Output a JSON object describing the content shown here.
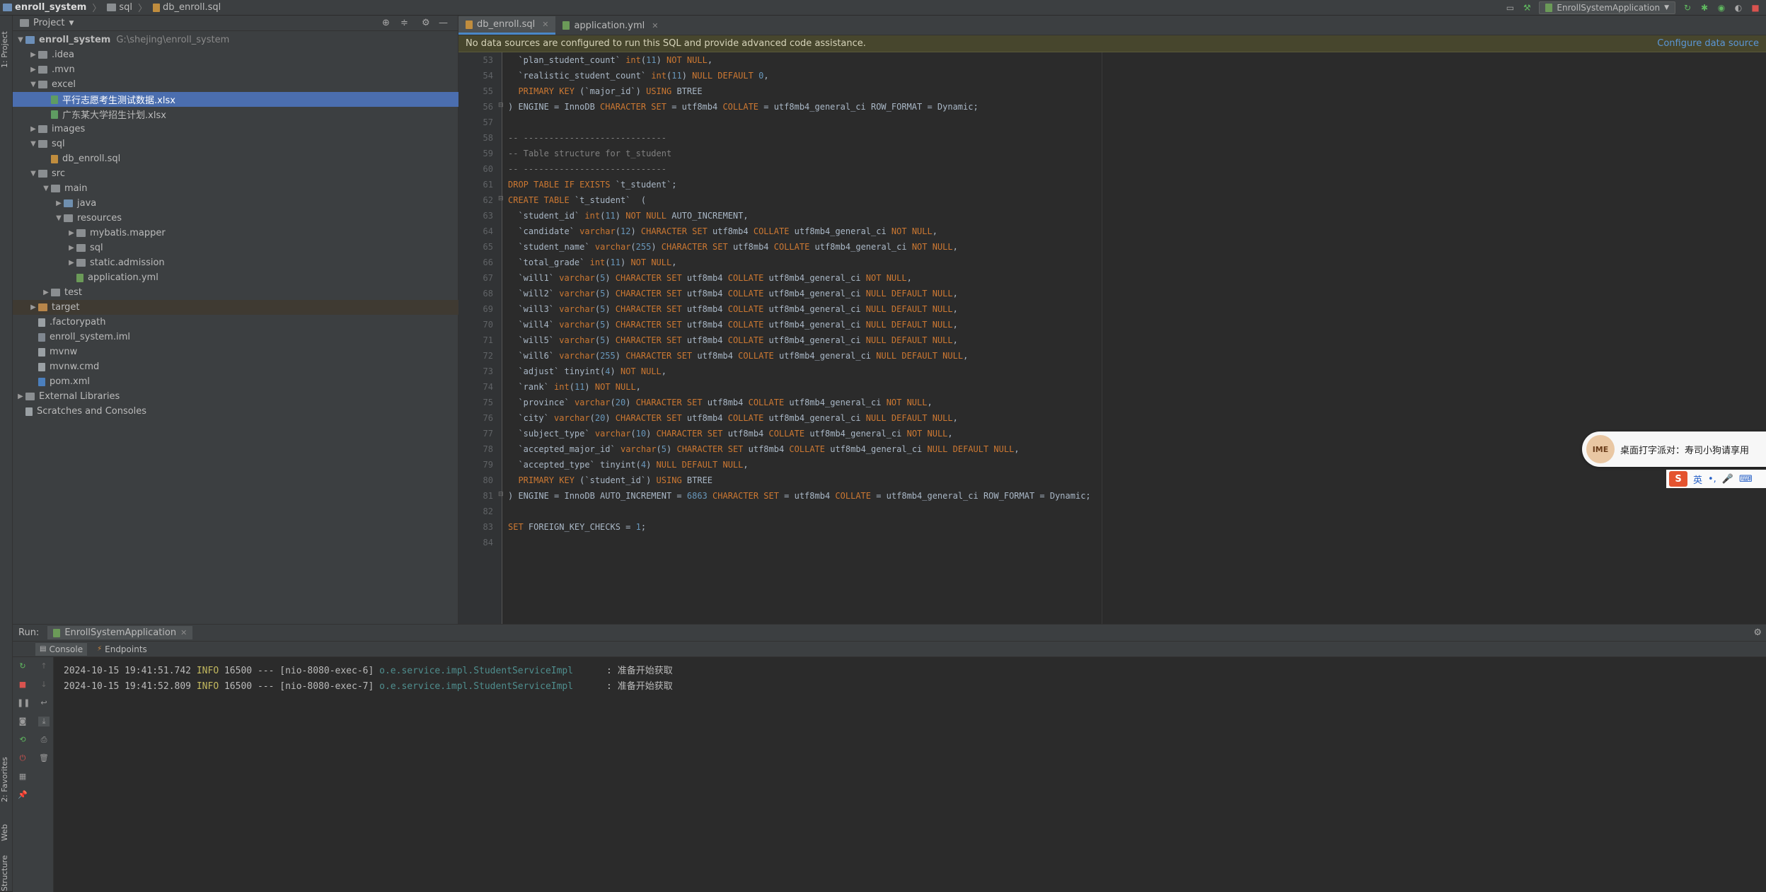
{
  "breadcrumb": {
    "project": "enroll_system",
    "folder": "sql",
    "file": "db_enroll.sql"
  },
  "toolbar": {
    "run_config": "EnrollSystemApplication"
  },
  "left_strip": {
    "project_tab": "1: Project",
    "favorites_tab": "2: Favorites",
    "web_tab": "Web",
    "structure_tab": "Structure"
  },
  "project_panel": {
    "title": "Project",
    "tree": [
      {
        "label": "enroll_system",
        "path": "G:\\shejing\\enroll_system",
        "depth": 0,
        "arrow": "▼",
        "icon": "ficon blue",
        "bold": true
      },
      {
        "label": ".idea",
        "depth": 1,
        "arrow": "▶",
        "icon": "ficon"
      },
      {
        "label": ".mvn",
        "depth": 1,
        "arrow": "▶",
        "icon": "ficon"
      },
      {
        "label": "excel",
        "depth": 1,
        "arrow": "▼",
        "icon": "ficon"
      },
      {
        "label": "平行志愿考生测试数据.xlsx",
        "depth": 2,
        "arrow": "",
        "icon": "fileicon xls",
        "selected": true
      },
      {
        "label": "广东某大学招生计划.xlsx",
        "depth": 2,
        "arrow": "",
        "icon": "fileicon xls"
      },
      {
        "label": "images",
        "depth": 1,
        "arrow": "▶",
        "icon": "ficon"
      },
      {
        "label": "sql",
        "depth": 1,
        "arrow": "▼",
        "icon": "ficon"
      },
      {
        "label": "db_enroll.sql",
        "depth": 2,
        "arrow": "",
        "icon": "fileicon sql"
      },
      {
        "label": "src",
        "depth": 1,
        "arrow": "▼",
        "icon": "ficon"
      },
      {
        "label": "main",
        "depth": 2,
        "arrow": "▼",
        "icon": "ficon"
      },
      {
        "label": "java",
        "depth": 3,
        "arrow": "▶",
        "icon": "ficon src"
      },
      {
        "label": "resources",
        "depth": 3,
        "arrow": "▼",
        "icon": "ficon"
      },
      {
        "label": "mybatis.mapper",
        "depth": 4,
        "arrow": "▶",
        "icon": "ficon"
      },
      {
        "label": "sql",
        "depth": 4,
        "arrow": "▶",
        "icon": "ficon"
      },
      {
        "label": "static.admission",
        "depth": 4,
        "arrow": "▶",
        "icon": "ficon"
      },
      {
        "label": "application.yml",
        "depth": 4,
        "arrow": "",
        "icon": "fileicon yml"
      },
      {
        "label": "test",
        "depth": 2,
        "arrow": "▶",
        "icon": "ficon"
      },
      {
        "label": "target",
        "depth": 1,
        "arrow": "▶",
        "icon": "ficon orange",
        "target": true
      },
      {
        "label": ".factorypath",
        "depth": 1,
        "arrow": "",
        "icon": "fileicon"
      },
      {
        "label": "enroll_system.iml",
        "depth": 1,
        "arrow": "",
        "icon": "fileicon iml"
      },
      {
        "label": "mvnw",
        "depth": 1,
        "arrow": "",
        "icon": "fileicon"
      },
      {
        "label": "mvnw.cmd",
        "depth": 1,
        "arrow": "",
        "icon": "fileicon"
      },
      {
        "label": "pom.xml",
        "depth": 1,
        "arrow": "",
        "icon": "fileicon pom"
      },
      {
        "label": "External Libraries",
        "depth": 0,
        "arrow": "▶",
        "icon": "ficon"
      },
      {
        "label": "Scratches and Consoles",
        "depth": 0,
        "arrow": "",
        "icon": "fileicon"
      }
    ]
  },
  "editor": {
    "tabs": [
      {
        "label": "db_enroll.sql",
        "active": true
      },
      {
        "label": "application.yml",
        "active": false
      }
    ],
    "banner": {
      "message": "No data sources are configured to run this SQL and provide advanced code assistance.",
      "link": "Configure data source"
    },
    "lines": [
      {
        "n": "53",
        "html": "  <span class='id'>`plan_student_count`</span> <span class='kw'>int</span>(<span class='num'>11</span>) <span class='kw'>NOT NULL</span>,"
      },
      {
        "n": "54",
        "html": "  <span class='id'>`realistic_student_count`</span> <span class='kw'>int</span>(<span class='num'>11</span>) <span class='kw'>NULL DEFAULT</span> <span class='num'>0</span>,"
      },
      {
        "n": "55",
        "html": "  <span class='kw'>PRIMARY KEY</span> (<span class='id'>`major_id`</span>) <span class='kw'>USING</span> BTREE"
      },
      {
        "n": "56",
        "html": ") ENGINE = InnoDB <span class='kw'>CHARACTER SET</span> = utf8mb4 <span class='kw'>COLLATE</span> = utf8mb4_general_ci ROW_FORMAT = Dynamic;"
      },
      {
        "n": "57",
        "html": ""
      },
      {
        "n": "58",
        "html": "<span class='cm'>-- ----------------------------</span>"
      },
      {
        "n": "59",
        "html": "<span class='cm'>-- Table structure for t_student</span>"
      },
      {
        "n": "60",
        "html": "<span class='cm'>-- ----------------------------</span>"
      },
      {
        "n": "61",
        "html": "<span class='kw'>DROP TABLE IF EXISTS</span> <span class='id'>`t_student`</span>;"
      },
      {
        "n": "62",
        "html": "<span class='kw'>CREATE TABLE</span> <span class='id'>`t_student`</span>  ("
      },
      {
        "n": "63",
        "html": "  <span class='id'>`student_id`</span> <span class='kw'>int</span>(<span class='num'>11</span>) <span class='kw'>NOT NULL</span> AUTO_INCREMENT,"
      },
      {
        "n": "64",
        "html": "  <span class='id'>`candidate`</span> <span class='kw'>varchar</span>(<span class='num'>12</span>) <span class='kw'>CHARACTER SET</span> utf8mb4 <span class='kw'>COLLATE</span> utf8mb4_general_ci <span class='kw'>NOT NULL</span>,"
      },
      {
        "n": "65",
        "html": "  <span class='id'>`student_name`</span> <span class='kw'>varchar</span>(<span class='num'>255</span>) <span class='kw'>CHARACTER SET</span> utf8mb4 <span class='kw'>COLLATE</span> utf8mb4_general_ci <span class='kw'>NOT NULL</span>,"
      },
      {
        "n": "66",
        "html": "  <span class='id'>`total_grade`</span> <span class='kw'>int</span>(<span class='num'>11</span>) <span class='kw'>NOT NULL</span>,"
      },
      {
        "n": "67",
        "html": "  <span class='id'>`will1`</span> <span class='kw'>varchar</span>(<span class='num'>5</span>) <span class='kw'>CHARACTER SET</span> utf8mb4 <span class='kw'>COLLATE</span> utf8mb4_general_ci <span class='kw'>NOT NULL</span>,"
      },
      {
        "n": "68",
        "html": "  <span class='id'>`will2`</span> <span class='kw'>varchar</span>(<span class='num'>5</span>) <span class='kw'>CHARACTER SET</span> utf8mb4 <span class='kw'>COLLATE</span> utf8mb4_general_ci <span class='kw'>NULL DEFAULT NULL</span>,"
      },
      {
        "n": "69",
        "html": "  <span class='id'>`will3`</span> <span class='kw'>varchar</span>(<span class='num'>5</span>) <span class='kw'>CHARACTER SET</span> utf8mb4 <span class='kw'>COLLATE</span> utf8mb4_general_ci <span class='kw'>NULL DEFAULT NULL</span>,"
      },
      {
        "n": "70",
        "html": "  <span class='id'>`will4`</span> <span class='kw'>varchar</span>(<span class='num'>5</span>) <span class='kw'>CHARACTER SET</span> utf8mb4 <span class='kw'>COLLATE</span> utf8mb4_general_ci <span class='kw'>NULL DEFAULT NULL</span>,"
      },
      {
        "n": "71",
        "html": "  <span class='id'>`will5`</span> <span class='kw'>varchar</span>(<span class='num'>5</span>) <span class='kw'>CHARACTER SET</span> utf8mb4 <span class='kw'>COLLATE</span> utf8mb4_general_ci <span class='kw'>NULL DEFAULT NULL</span>,"
      },
      {
        "n": "72",
        "html": "  <span class='id'>`will6`</span> <span class='kw'>varchar</span>(<span class='num'>255</span>) <span class='kw'>CHARACTER SET</span> utf8mb4 <span class='kw'>COLLATE</span> utf8mb4_general_ci <span class='kw'>NULL DEFAULT NULL</span>,"
      },
      {
        "n": "73",
        "html": "  <span class='id'>`adjust`</span> tinyint(<span class='num'>4</span>) <span class='kw'>NOT NULL</span>,"
      },
      {
        "n": "74",
        "html": "  <span class='id'>`rank`</span> <span class='kw'>int</span>(<span class='num'>11</span>) <span class='kw'>NOT NULL</span>,"
      },
      {
        "n": "75",
        "html": "  <span class='id'>`province`</span> <span class='kw'>varchar</span>(<span class='num'>20</span>) <span class='kw'>CHARACTER SET</span> utf8mb4 <span class='kw'>COLLATE</span> utf8mb4_general_ci <span class='kw'>NOT NULL</span>,"
      },
      {
        "n": "76",
        "html": "  <span class='id'>`city`</span> <span class='kw'>varchar</span>(<span class='num'>20</span>) <span class='kw'>CHARACTER SET</span> utf8mb4 <span class='kw'>COLLATE</span> utf8mb4_general_ci <span class='kw'>NULL DEFAULT NULL</span>,"
      },
      {
        "n": "77",
        "html": "  <span class='id'>`subject_type`</span> <span class='kw'>varchar</span>(<span class='num'>10</span>) <span class='kw'>CHARACTER SET</span> utf8mb4 <span class='kw'>COLLATE</span> utf8mb4_general_ci <span class='kw'>NOT NULL</span>,"
      },
      {
        "n": "78",
        "html": "  <span class='id'>`accepted_major_id`</span> <span class='kw'>varchar</span>(<span class='num'>5</span>) <span class='kw'>CHARACTER SET</span> utf8mb4 <span class='kw'>COLLATE</span> utf8mb4_general_ci <span class='kw'>NULL DEFAULT NULL</span>,"
      },
      {
        "n": "79",
        "html": "  <span class='id'>`accepted_type`</span> tinyint(<span class='num'>4</span>) <span class='kw'>NULL DEFAULT NULL</span>,"
      },
      {
        "n": "80",
        "html": "  <span class='kw'>PRIMARY KEY</span> (<span class='id'>`student_id`</span>) <span class='kw'>USING</span> BTREE"
      },
      {
        "n": "81",
        "html": ") ENGINE = InnoDB AUTO_INCREMENT = <span class='num'>6863</span> <span class='kw'>CHARACTER SET</span> = utf8mb4 <span class='kw'>COLLATE</span> = utf8mb4_general_ci ROW_FORMAT = Dynamic;"
      },
      {
        "n": "82",
        "html": ""
      },
      {
        "n": "83",
        "html": "<span class='kw'>SET</span> FOREIGN_KEY_CHECKS = <span class='num'>1</span>;"
      },
      {
        "n": "84",
        "html": ""
      }
    ]
  },
  "ime": {
    "message": "桌面打字派对：寿司小狗请享用",
    "avatar": "IME",
    "lang": "英"
  },
  "run_panel": {
    "label": "Run:",
    "config": "EnrollSystemApplication",
    "tabs": [
      "Console",
      "Endpoints"
    ],
    "logs": [
      {
        "ts": "2024-10-15 19:41:51.742",
        "lvl": "INFO",
        "pid": "16500 --- [nio-8080-exec-6]",
        "cls": "o.e.service.impl.StudentServiceImpl",
        "msg": ": 准备开始获取"
      },
      {
        "ts": "2024-10-15 19:41:52.809",
        "lvl": "INFO",
        "pid": "16500 --- [nio-8080-exec-7]",
        "cls": "o.e.service.impl.StudentServiceImpl",
        "msg": ": 准备开始获取"
      }
    ]
  }
}
